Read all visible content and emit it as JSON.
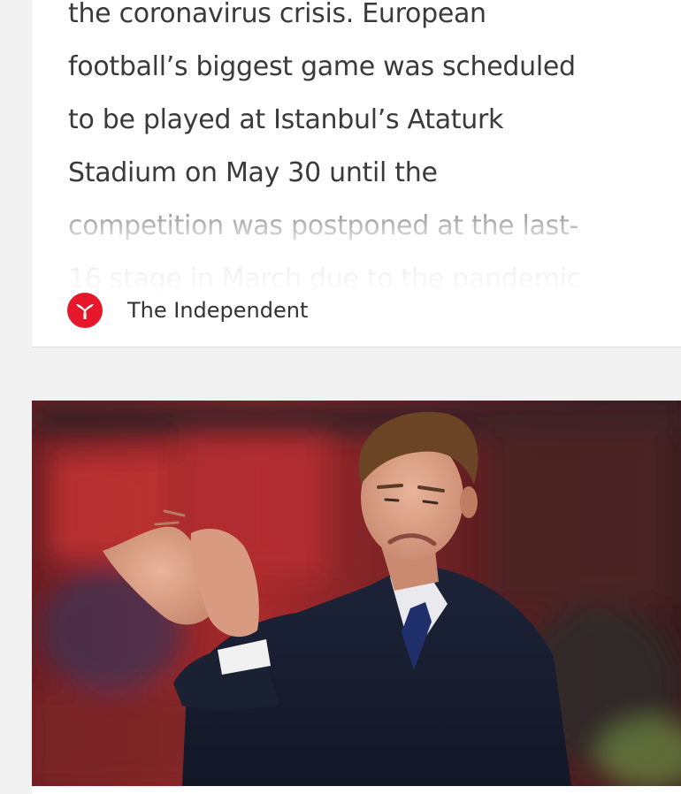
{
  "article_card": {
    "snippet_lines": [
      "the coronavirus crisis. European",
      "football’s biggest game was scheduled",
      "to be played at Istanbul’s Ataturk",
      "Stadium on May 30 until the",
      "competition was postponed at the last-",
      "16 stage in March due to the pandemic"
    ],
    "source": {
      "name": "The Independent",
      "logo_icon": "independent-eagle-logo",
      "logo_color": "#e4172b"
    }
  },
  "image_card": {
    "photo_icon": "football-manager-applauding-photo"
  }
}
